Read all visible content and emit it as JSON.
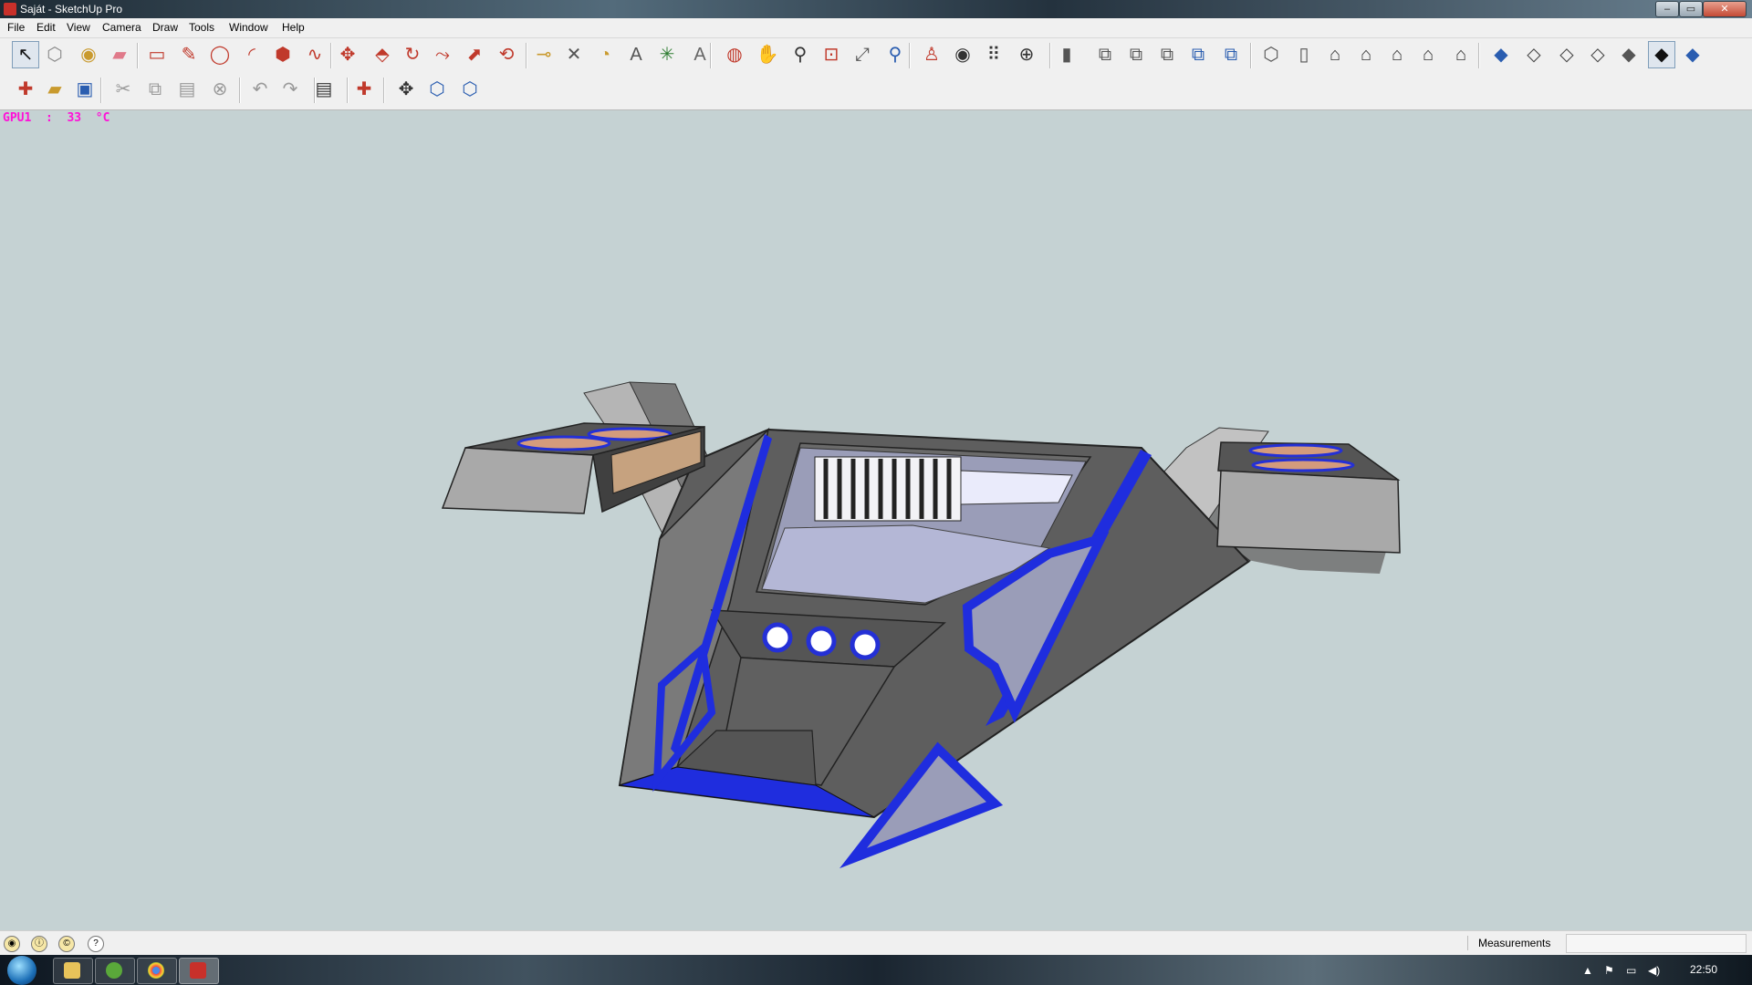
{
  "window": {
    "title": "Saját - SketchUp Pro",
    "controls": [
      "–",
      "▭",
      "✕"
    ]
  },
  "menu": [
    "File",
    "Edit",
    "View",
    "Camera",
    "Draw",
    "Tools",
    "Window",
    "Help"
  ],
  "toolbar_row1": [
    {
      "icon": "select-arrow-icon",
      "glyph": "↖",
      "color": "#111111",
      "active": true
    },
    {
      "icon": "make-component-icon",
      "glyph": "⬡",
      "color": "#8a8a8a"
    },
    {
      "icon": "paint-bucket-icon",
      "glyph": "◉",
      "color": "#c99a2e"
    },
    {
      "icon": "eraser-icon",
      "glyph": "▰",
      "color": "#e07a8a"
    },
    {
      "icon": "rectangle-icon",
      "glyph": "▭",
      "color": "#c0392b"
    },
    {
      "icon": "line-pencil-icon",
      "glyph": "✎",
      "color": "#c0392b"
    },
    {
      "icon": "circle-icon",
      "glyph": "◯",
      "color": "#c0392b"
    },
    {
      "icon": "arc-icon",
      "glyph": "◜",
      "color": "#c0392b"
    },
    {
      "icon": "polygon-icon",
      "glyph": "⬢",
      "color": "#c0392b"
    },
    {
      "icon": "freehand-icon",
      "glyph": "∿",
      "color": "#c0392b"
    },
    {
      "icon": "move-icon",
      "glyph": "✥",
      "color": "#c0392b"
    },
    {
      "icon": "push-pull-icon",
      "glyph": "⬘",
      "color": "#c0392b"
    },
    {
      "icon": "rotate-icon",
      "glyph": "↻",
      "color": "#c0392b"
    },
    {
      "icon": "follow-me-icon",
      "glyph": "⤳",
      "color": "#c0392b"
    },
    {
      "icon": "scale-icon",
      "glyph": "⬈",
      "color": "#c0392b"
    },
    {
      "icon": "offset-icon",
      "glyph": "⟲",
      "color": "#c0392b"
    },
    {
      "icon": "tape-measure-icon",
      "glyph": "⊸",
      "color": "#c99a2e"
    },
    {
      "icon": "dimension-icon",
      "glyph": "✕",
      "color": "#555555"
    },
    {
      "icon": "protractor-icon",
      "glyph": "◔",
      "color": "#c99a2e"
    },
    {
      "icon": "text-icon",
      "glyph": "A",
      "color": "#555555"
    },
    {
      "icon": "axes-icon",
      "glyph": "✳",
      "color": "#2e7d32"
    },
    {
      "icon": "3d-text-icon",
      "glyph": "A",
      "color": "#666666"
    },
    {
      "icon": "orbit-icon",
      "glyph": "◍",
      "color": "#c0392b"
    },
    {
      "icon": "pan-hand-icon",
      "glyph": "✋",
      "color": "#555555"
    },
    {
      "icon": "zoom-icon",
      "glyph": "⚲",
      "color": "#333333"
    },
    {
      "icon": "zoom-window-icon",
      "glyph": "⊡",
      "color": "#c0392b"
    },
    {
      "icon": "zoom-extents-icon",
      "glyph": "⤢",
      "color": "#555555"
    },
    {
      "icon": "previous-view-icon",
      "glyph": "⚲",
      "color": "#2a5db0"
    },
    {
      "icon": "position-camera-icon",
      "glyph": "♙",
      "color": "#c0392b"
    },
    {
      "icon": "look-around-icon",
      "glyph": "◉",
      "color": "#333333"
    },
    {
      "icon": "walk-icon",
      "glyph": "⠿",
      "color": "#333333"
    },
    {
      "icon": "section-plane-icon",
      "glyph": "⊕",
      "color": "#333333"
    },
    {
      "icon": "display-section-planes-icon",
      "glyph": "▮",
      "color": "#555555"
    },
    {
      "icon": "iso-view-icon",
      "glyph": "⧉",
      "color": "#555555"
    },
    {
      "icon": "top-view-icon",
      "glyph": "⧉",
      "color": "#555555"
    },
    {
      "icon": "front-view-icon",
      "glyph": "⧉",
      "color": "#555555"
    },
    {
      "icon": "right-view-icon",
      "glyph": "⧉",
      "color": "#2a5db0"
    },
    {
      "icon": "back-view-icon",
      "glyph": "⧉",
      "color": "#2a5db0"
    },
    {
      "icon": "xray-icon",
      "glyph": "⬡",
      "color": "#555555"
    },
    {
      "icon": "back-edges-icon",
      "glyph": "▯",
      "color": "#555555"
    },
    {
      "icon": "house-wireframe-icon",
      "glyph": "⌂",
      "color": "#333333"
    },
    {
      "icon": "house-hidden-line-icon",
      "glyph": "⌂",
      "color": "#333333"
    },
    {
      "icon": "house-shaded-icon",
      "glyph": "⌂",
      "color": "#333333"
    },
    {
      "icon": "house-textures-icon",
      "glyph": "⌂",
      "color": "#333333"
    },
    {
      "icon": "house-monochrome-icon",
      "glyph": "⌂",
      "color": "#333333"
    },
    {
      "icon": "style-xray-icon",
      "glyph": "◆",
      "color": "#2a5db0"
    },
    {
      "icon": "style-back-edges-icon",
      "glyph": "◇",
      "color": "#444444"
    },
    {
      "icon": "style-wireframe-icon",
      "glyph": "◇",
      "color": "#444444"
    },
    {
      "icon": "style-hidden-line-icon",
      "glyph": "◇",
      "color": "#444444"
    },
    {
      "icon": "style-shaded-icon",
      "glyph": "◆",
      "color": "#555555"
    },
    {
      "icon": "style-shaded-textures-icon",
      "glyph": "◆",
      "color": "#111111",
      "active": true
    },
    {
      "icon": "style-monochrome-icon",
      "glyph": "◆",
      "color": "#2a5db0"
    }
  ],
  "toolbar_row2": [
    {
      "icon": "new-file-icon",
      "glyph": "✚",
      "color": "#c0392b"
    },
    {
      "icon": "open-folder-icon",
      "glyph": "▰",
      "color": "#c99a2e"
    },
    {
      "icon": "save-icon",
      "glyph": "▣",
      "color": "#2a5db0"
    },
    {
      "icon": "cut-icon",
      "glyph": "✂",
      "color": "#999999"
    },
    {
      "icon": "copy-icon",
      "glyph": "⧉",
      "color": "#999999"
    },
    {
      "icon": "paste-icon",
      "glyph": "▤",
      "color": "#999999"
    },
    {
      "icon": "delete-icon",
      "glyph": "⊗",
      "color": "#999999"
    },
    {
      "icon": "undo-icon",
      "glyph": "↶",
      "color": "#999999"
    },
    {
      "icon": "redo-icon",
      "glyph": "↷",
      "color": "#999999"
    },
    {
      "icon": "print-icon",
      "glyph": "▤",
      "color": "#333333"
    },
    {
      "icon": "model-info-icon",
      "glyph": "✚",
      "color": "#c0392b"
    },
    {
      "icon": "get-location-icon",
      "glyph": "✥",
      "color": "#333333"
    },
    {
      "icon": "3d-warehouse-icon",
      "glyph": "⬡",
      "color": "#2a5db0"
    },
    {
      "icon": "share-model-icon",
      "glyph": "⬡",
      "color": "#2a5db0"
    }
  ],
  "viewport": {
    "overlay_text": "GPU1  :  33  °C",
    "background": "#c5d2d3",
    "model_colors": {
      "body": "#5e5e5e",
      "trim": "#2430d6",
      "glass": "#b5b9dc",
      "copper": "#d49b7c"
    }
  },
  "statusbar": {
    "icons": [
      "geo-location-icon",
      "credits-icon",
      "copyright-icon",
      "help-icon"
    ],
    "measurements_label": "Measurements",
    "measurements_value": ""
  },
  "taskbar": {
    "apps": [
      "file-explorer-icon",
      "utorrent-icon",
      "chrome-icon",
      "sketchup-icon"
    ],
    "tray": [
      "▲",
      "⚑",
      "▭",
      "◀)"
    ],
    "clock": "22:50"
  }
}
